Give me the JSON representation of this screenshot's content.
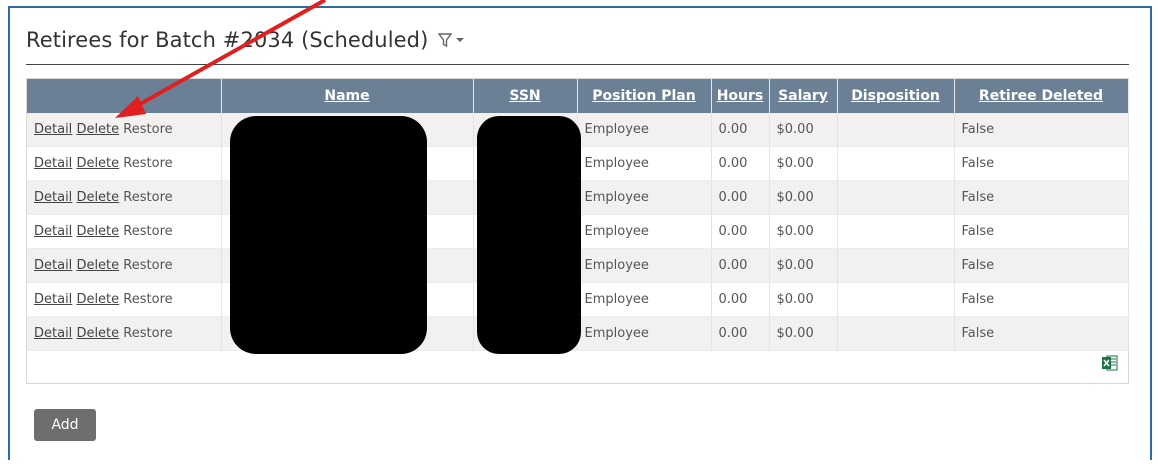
{
  "header": {
    "title": "Retirees for Batch #2034 (Scheduled)"
  },
  "table": {
    "columns": [
      "",
      "Name",
      "SSN",
      "Position Plan",
      "Hours",
      "Salary",
      "Disposition",
      "Retiree Deleted"
    ],
    "action_labels": {
      "detail": "Detail",
      "delete": "Delete",
      "restore": "Restore"
    },
    "rows": [
      {
        "name": "",
        "ssn": "",
        "position_plan": "Employee",
        "hours": "0.00",
        "salary": "$0.00",
        "disposition": "",
        "retiree_deleted": "False"
      },
      {
        "name": "",
        "ssn": "",
        "position_plan": "Employee",
        "hours": "0.00",
        "salary": "$0.00",
        "disposition": "",
        "retiree_deleted": "False"
      },
      {
        "name": "",
        "ssn": "",
        "position_plan": "Employee",
        "hours": "0.00",
        "salary": "$0.00",
        "disposition": "",
        "retiree_deleted": "False"
      },
      {
        "name": "",
        "ssn": "",
        "position_plan": "Employee",
        "hours": "0.00",
        "salary": "$0.00",
        "disposition": "",
        "retiree_deleted": "False"
      },
      {
        "name": "",
        "ssn": "",
        "position_plan": "Employee",
        "hours": "0.00",
        "salary": "$0.00",
        "disposition": "",
        "retiree_deleted": "False"
      },
      {
        "name": "",
        "ssn": "",
        "position_plan": "Employee",
        "hours": "0.00",
        "salary": "$0.00",
        "disposition": "",
        "retiree_deleted": "False"
      },
      {
        "name": "",
        "ssn": "",
        "position_plan": "Employee",
        "hours": "0.00",
        "salary": "$0.00",
        "disposition": "",
        "retiree_deleted": "False"
      }
    ]
  },
  "footer": {
    "add_label": "Add",
    "export_icon": "excel-icon"
  },
  "colors": {
    "header_bg": "#6b8095",
    "panel_border": "#2e6da4",
    "annotation_arrow": "#e02020",
    "add_button_bg": "#6e6e6e",
    "excel_green": "#1e7145"
  }
}
